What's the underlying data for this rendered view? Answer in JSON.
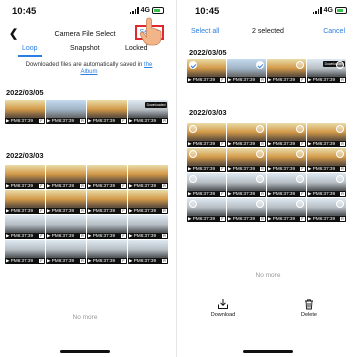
{
  "left": {
    "time": "10:45",
    "network": "4G",
    "title": "Camera File Select",
    "select_label": "Select",
    "tabs": [
      "Loop",
      "Snapshot",
      "Locked"
    ],
    "notice_text": "Downloaded files are automatically saved in",
    "notice_link": "the Album",
    "sections": [
      {
        "date": "2022/03/05",
        "items": [
          {
            "caption": "▶ PM6:37:39",
            "tag": "F",
            "variant": "a"
          },
          {
            "caption": "▶ PM6:37:39",
            "tag": "R",
            "variant": "b"
          },
          {
            "caption": "▶ PM6:37:39",
            "tag": "F",
            "variant": "a"
          },
          {
            "caption": "▶ PM6:37:39",
            "tag": "R",
            "variant": "c",
            "badge": "Downloaded"
          }
        ]
      },
      {
        "date": "2022/03/03",
        "items": [
          {
            "caption": "▶ PM6:37:39",
            "tag": "F",
            "variant": "a"
          },
          {
            "caption": "▶ PM6:37:39",
            "tag": "R",
            "variant": "a"
          },
          {
            "caption": "▶ PM6:37:39",
            "tag": "F",
            "variant": "a"
          },
          {
            "caption": "▶ PM6:37:39",
            "tag": "R",
            "variant": "a"
          },
          {
            "caption": "▶ PM6:37:39",
            "tag": "F",
            "variant": "a"
          },
          {
            "caption": "▶ PM6:37:39",
            "tag": "R",
            "variant": "a"
          },
          {
            "caption": "▶ PM6:37:39",
            "tag": "F",
            "variant": "a"
          },
          {
            "caption": "▶ PM6:37:39",
            "tag": "R",
            "variant": "a"
          },
          {
            "caption": "▶ PM6:37:39",
            "tag": "F",
            "variant": "c"
          },
          {
            "caption": "▶ PM6:37:39",
            "tag": "R",
            "variant": "c"
          },
          {
            "caption": "▶ PM6:37:39",
            "tag": "F",
            "variant": "c"
          },
          {
            "caption": "▶ PM6:37:39",
            "tag": "R",
            "variant": "c"
          },
          {
            "caption": "▶ PM6:37:39",
            "tag": "F",
            "variant": "c"
          },
          {
            "caption": "▶ PM6:37:39",
            "tag": "R",
            "variant": "c"
          },
          {
            "caption": "▶ PM6:37:39",
            "tag": "F",
            "variant": "c"
          },
          {
            "caption": "▶ PM6:37:39",
            "tag": "R",
            "variant": "c"
          }
        ]
      }
    ],
    "no_more": "No more"
  },
  "right": {
    "time": "10:45",
    "network": "4G",
    "select_all": "Select all",
    "selected_count": "2 selected",
    "cancel": "Cancel",
    "sections": [
      {
        "date": "2022/03/05",
        "items": [
          {
            "caption": "▶ PM6:37:39",
            "tag": "F",
            "variant": "a",
            "checked": true
          },
          {
            "caption": "▶ PM6:37:39",
            "tag": "R",
            "variant": "b",
            "checked": true
          },
          {
            "caption": "▶ PM6:37:39",
            "tag": "F",
            "variant": "a",
            "checked": false
          },
          {
            "caption": "▶ PM6:37:39",
            "tag": "R",
            "variant": "c",
            "checked": false,
            "badge": "Downloaded"
          }
        ]
      },
      {
        "date": "2022/03/03",
        "items": [
          {
            "caption": "▶ PM6:37:39",
            "tag": "F",
            "variant": "a",
            "checked": false
          },
          {
            "caption": "▶ PM6:37:39",
            "tag": "R",
            "variant": "a",
            "checked": false
          },
          {
            "caption": "▶ PM6:37:39",
            "tag": "F",
            "variant": "a",
            "checked": false
          },
          {
            "caption": "▶ PM6:37:39",
            "tag": "R",
            "variant": "a",
            "checked": false
          },
          {
            "caption": "▶ PM6:37:39",
            "tag": "F",
            "variant": "a",
            "checked": false
          },
          {
            "caption": "▶ PM6:37:39",
            "tag": "R",
            "variant": "a",
            "checked": false
          },
          {
            "caption": "▶ PM6:37:39",
            "tag": "F",
            "variant": "a",
            "checked": false
          },
          {
            "caption": "▶ PM6:37:39",
            "tag": "R",
            "variant": "a",
            "checked": false
          },
          {
            "caption": "▶ PM6:37:39",
            "tag": "F",
            "variant": "c",
            "checked": false
          },
          {
            "caption": "▶ PM6:37:39",
            "tag": "R",
            "variant": "c",
            "checked": false
          },
          {
            "caption": "▶ PM6:37:39",
            "tag": "F",
            "variant": "c",
            "checked": false
          },
          {
            "caption": "▶ PM6:37:39",
            "tag": "R",
            "variant": "c",
            "checked": false
          },
          {
            "caption": "▶ PM6:37:39",
            "tag": "F",
            "variant": "c",
            "checked": false
          },
          {
            "caption": "▶ PM6:37:39",
            "tag": "R",
            "variant": "c",
            "checked": false
          },
          {
            "caption": "▶ PM6:37:39",
            "tag": "F",
            "variant": "c",
            "checked": false
          },
          {
            "caption": "▶ PM6:37:39",
            "tag": "R",
            "variant": "c",
            "checked": false
          }
        ]
      }
    ],
    "no_more": "No more",
    "toolbar": {
      "download": "Download",
      "delete": "Delete"
    }
  },
  "colors": {
    "accent": "#2a7de1",
    "highlight": "#e0282e",
    "battery": "#3cc04a"
  }
}
